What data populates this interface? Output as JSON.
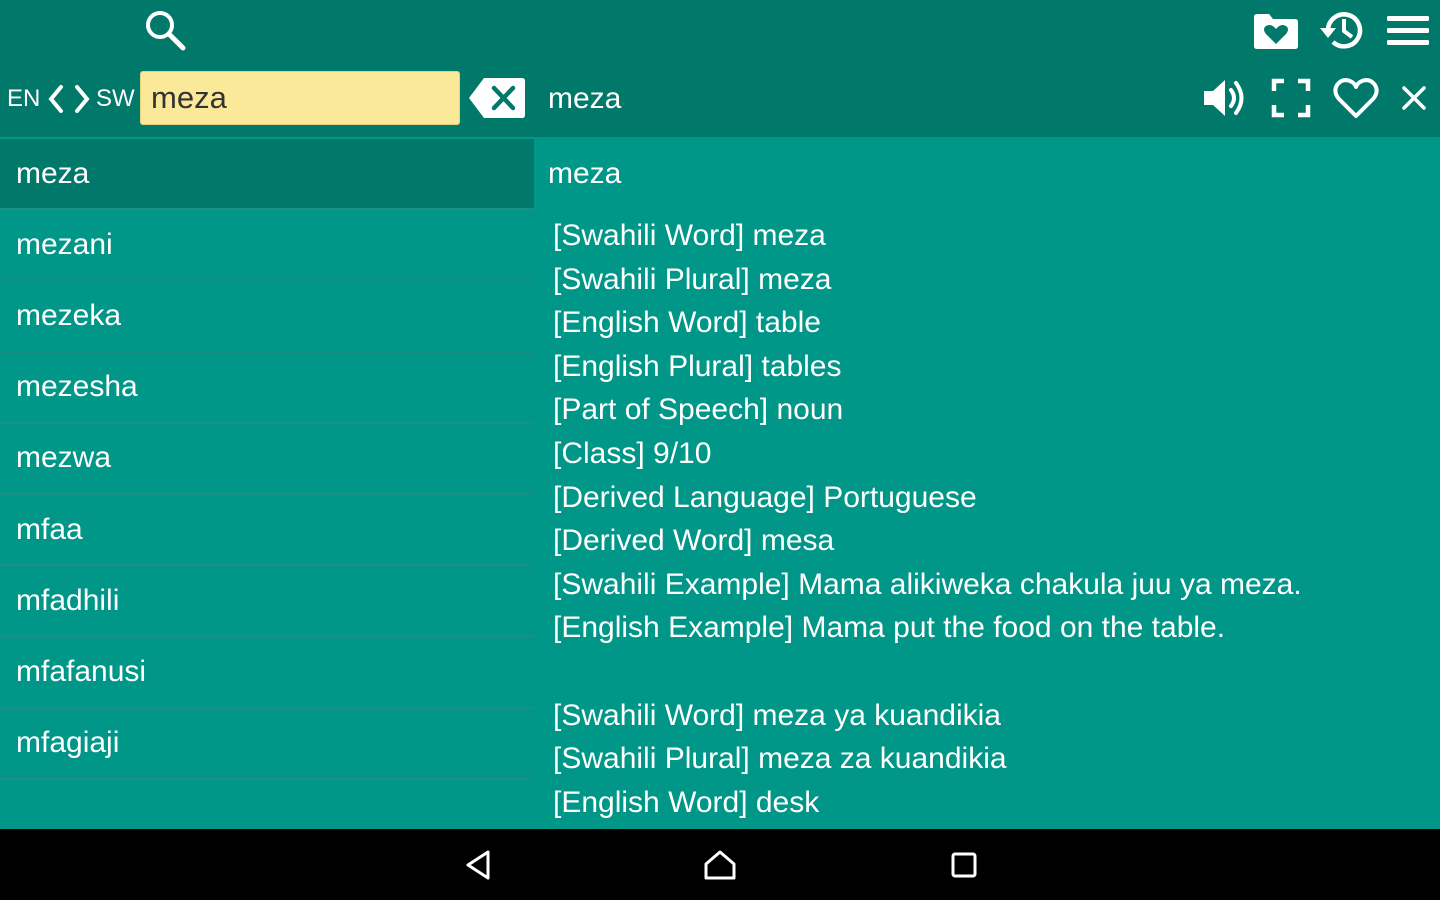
{
  "toolbar": {
    "icons": [
      "search-icon",
      "favorite-folder-icon",
      "history-icon",
      "menu-icon"
    ]
  },
  "search": {
    "source_lang": "EN",
    "target_lang": "SW",
    "value": "meza",
    "placeholder": ""
  },
  "header": {
    "word": "meza",
    "icons": [
      "speaker-icon",
      "fullscreen-icon",
      "heart-icon",
      "close-icon"
    ]
  },
  "word_list": [
    {
      "label": "meza",
      "selected": true
    },
    {
      "label": "mezani"
    },
    {
      "label": "mezeka"
    },
    {
      "label": "mezesha"
    },
    {
      "label": "mezwa"
    },
    {
      "label": "mfaa"
    },
    {
      "label": "mfadhili"
    },
    {
      "label": "mfafanusi"
    },
    {
      "label": "mfagiaji"
    }
  ],
  "detail": {
    "title": "meza",
    "lines": [
      "[Swahili Word] meza",
      "[Swahili Plural] meza",
      "[English Word] table",
      "[English Plural] tables",
      "[Part of Speech] noun",
      "[Class] 9/10",
      "[Derived Language] Portuguese",
      "[Derived Word] mesa",
      "[Swahili Example] Mama alikiweka chakula juu ya meza.",
      "[English Example] Mama put the food on the table.",
      "",
      "[Swahili Word] meza ya kuandikia",
      "[Swahili Plural] meza za kuandikia",
      "[English Word] desk"
    ]
  },
  "navbar": {
    "icons": [
      "back-icon",
      "home-icon",
      "recents-icon"
    ]
  },
  "colors": {
    "toolbar": "#00796b",
    "content": "#009688",
    "search_field": "#fbe99a",
    "navbar": "#000000"
  }
}
